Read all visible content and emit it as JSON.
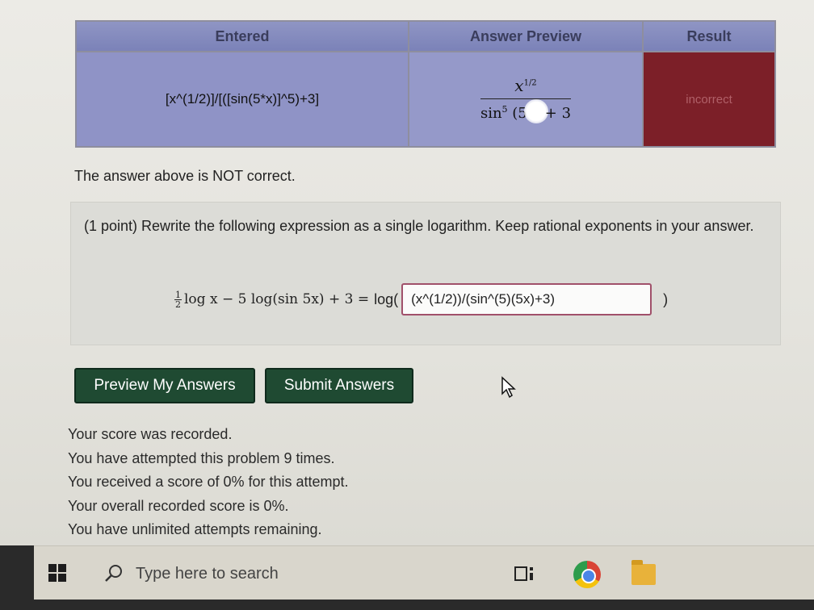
{
  "results_table": {
    "headers": {
      "entered": "Entered",
      "preview": "Answer Preview",
      "result": "Result"
    },
    "row": {
      "entered": "[x^(1/2)]/[([sin(5*x)]^5)+3]",
      "preview_numerator": "x",
      "preview_numerator_exp": "1/2",
      "preview_denominator_left": "sin",
      "preview_denominator_exp": "5",
      "preview_denominator_arg": "(5",
      "preview_denominator_right": "+ 3",
      "result": "incorrect"
    }
  },
  "feedback": {
    "message": "The answer above is NOT correct."
  },
  "problem": {
    "text": "(1 point) Rewrite the following expression as a single logarithm. Keep rational exponents in your answer.",
    "frac_num": "1",
    "frac_den": "2",
    "expression_rest": "log x − 5 log(sin 5x) + 3 =",
    "log_open": "log(",
    "answer_value": "(x^(1/2))/(sin^(5)(5x)+3)",
    "log_close": ")"
  },
  "buttons": {
    "preview": "Preview My Answers",
    "submit": "Submit Answers"
  },
  "score_info": {
    "lines": [
      "Your score was recorded.",
      "You have attempted this problem 9 times.",
      "You received a score of 0% for this attempt.",
      "Your overall recorded score is 0%.",
      "You have unlimited attempts remaining."
    ]
  },
  "taskbar": {
    "search_placeholder": "Type here to search",
    "icons": [
      "windows-start-icon",
      "search-icon",
      "task-view-icon",
      "chrome-icon",
      "file-explorer-icon"
    ]
  },
  "colors": {
    "button_bg": "#1f4a32",
    "result_incorrect_bg": "#7c1f28",
    "table_header_bg": "#8f95c4"
  }
}
